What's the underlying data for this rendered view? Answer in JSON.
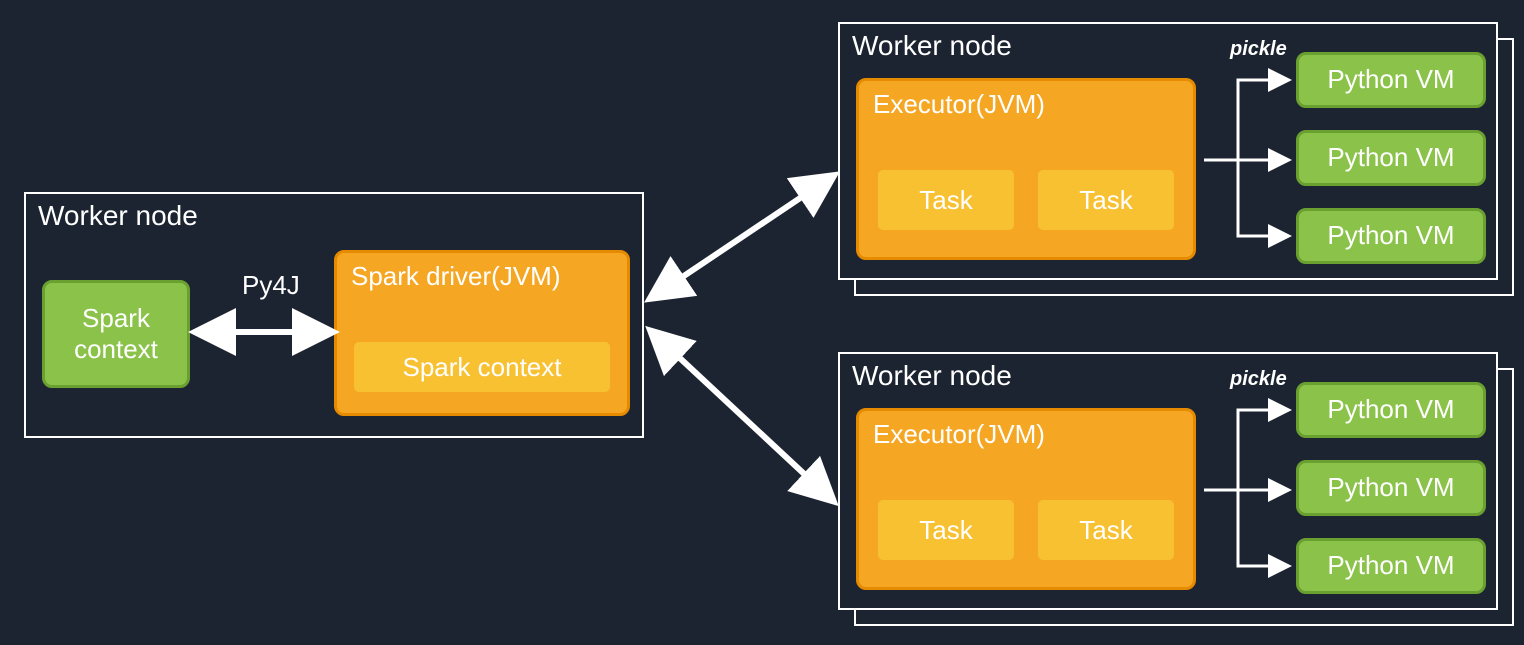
{
  "driverNode": {
    "title": "Worker node",
    "sparkContextGreen": "Spark\ncontext",
    "py4jLabel": "Py4J",
    "driverBox": {
      "title": "Spark driver(JVM)",
      "inner": "Spark context"
    }
  },
  "workerNodes": [
    {
      "title": "Worker node",
      "executor": {
        "title": "Executor(JVM)",
        "tasks": [
          "Task",
          "Task"
        ]
      },
      "pickle": "pickle",
      "pythonVMs": [
        "Python VM",
        "Python VM",
        "Python VM"
      ]
    },
    {
      "title": "Worker node",
      "executor": {
        "title": "Executor(JVM)",
        "tasks": [
          "Task",
          "Task"
        ]
      },
      "pickle": "pickle",
      "pythonVMs": [
        "Python VM",
        "Python VM",
        "Python VM"
      ]
    }
  ]
}
